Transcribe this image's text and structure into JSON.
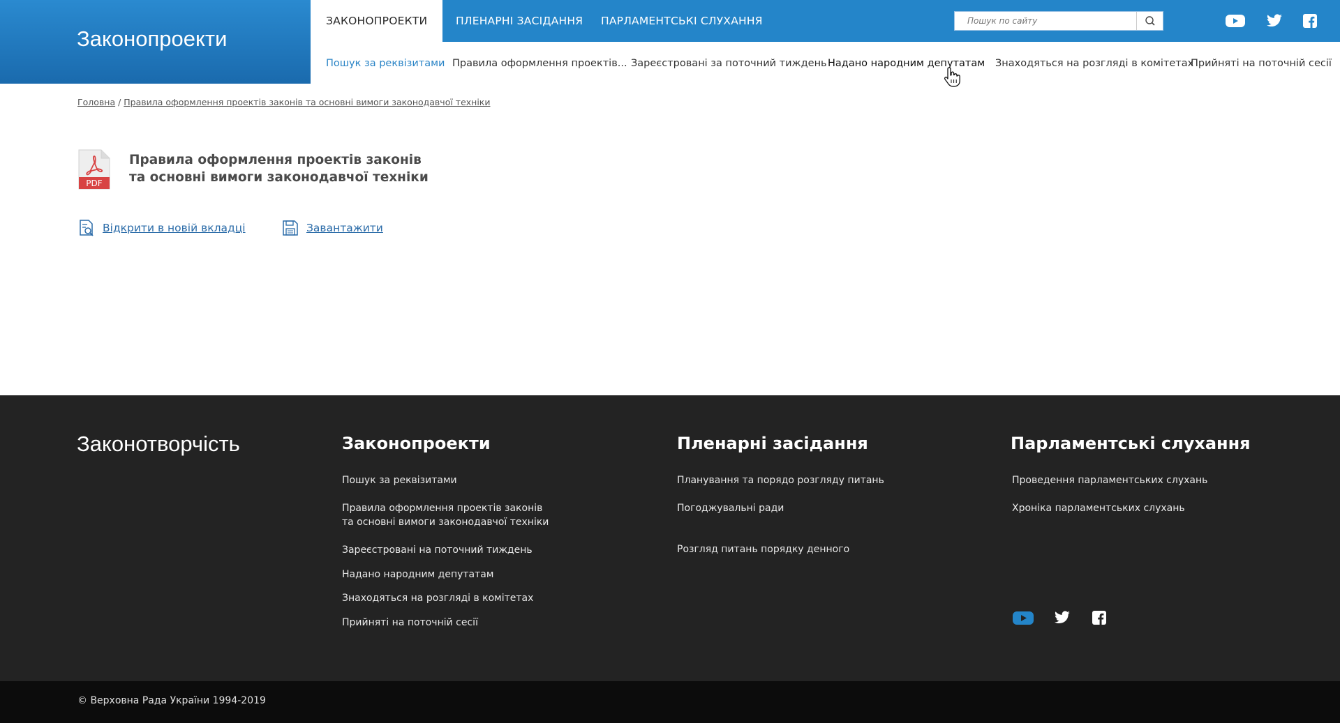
{
  "header": {
    "brand_title": "Законопроекти",
    "top_tabs": [
      {
        "label": "Законопроекти"
      },
      {
        "label": "Пленарні засідання"
      },
      {
        "label": "Парламентські слухання"
      }
    ],
    "search_placeholder": "Пошук по сайту",
    "social": [
      "youtube-icon",
      "twitter-icon",
      "facebook-icon"
    ],
    "colors": {
      "primary": "#2485c9",
      "brand_gradient_top": "#2a8ad0",
      "brand_gradient_bottom": "#1a6aad",
      "active_link": "#2a84c6"
    }
  },
  "subnav": {
    "items": [
      {
        "label": "Пошук за реквізитами"
      },
      {
        "label": "Правила оформлення проектів..."
      },
      {
        "label": "Зареєстровані за поточний тиждень"
      },
      {
        "label": "Надано народним депутатам"
      },
      {
        "label": "Знаходяться на розгляді в комітетах"
      },
      {
        "label": "Прийняті на поточній сесії"
      }
    ]
  },
  "breadcrumb": {
    "home": "Головна",
    "separator": " / ",
    "current": "Правила оформлення проектів законів та основні вимоги законодавчої техніки"
  },
  "document": {
    "icon_label": "PDF",
    "title_line1": "Правила оформлення проектів законів",
    "title_line2": "та основні вимоги законодавчої техніки",
    "open_label": "Відкрити в новій вкладці",
    "download_label": "Завантажити"
  },
  "footer": {
    "brand": "Законотворчість",
    "columns": [
      {
        "title": "Законопроекти",
        "links": [
          "Пошук за реквізитами",
          "Правила оформлення проектів законів",
          "та основні вимоги законодавчої техніки",
          "Зареєстровані на поточний тиждень",
          "Надано народним депутатам",
          "Знаходяться на розгляді в комітетах",
          "Прийняті на поточній сесії"
        ]
      },
      {
        "title": "Пленарні засідання",
        "links": [
          "Планування та порядо розгляду питань",
          "Погоджувальні ради",
          "Розгляд питань порядку денного"
        ]
      },
      {
        "title": "Парламентські слухання",
        "links": [
          "Проведення парламентських слухань",
          "Хроніка парламентських слухань"
        ]
      }
    ],
    "copyright": "© Верховна Рада України 1994-2019"
  }
}
